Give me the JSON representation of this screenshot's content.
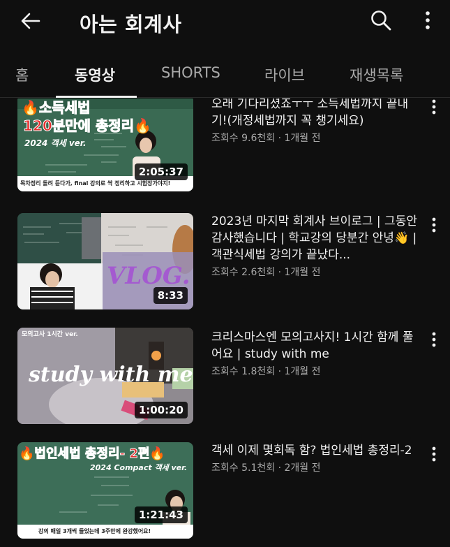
{
  "header": {
    "title": "아는 회계사",
    "back_icon": "arrow-left-icon",
    "search_icon": "search-icon",
    "more_icon": "more-vert-icon"
  },
  "tabs": [
    {
      "label": "홈",
      "active": false
    },
    {
      "label": "동영상",
      "active": true
    },
    {
      "label": "SHORTS",
      "active": false
    },
    {
      "label": "라이브",
      "active": false
    },
    {
      "label": "재생목록",
      "active": false
    }
  ],
  "videos": [
    {
      "title": "오래 기다리셨죠ㅜㅜ 소득세법까지 끝내기!(개정세법까지 꼭 챙기세요)",
      "stats": "조회수 9.6천회 · 1개월 전",
      "duration": "2:05:37",
      "thumb_line1": "🔥소득세법",
      "thumb_line2": "120분만에 총정리🔥",
      "thumb_sub": "2024 객세 ver.",
      "thumb_caption": "목차정리 돌려 듣다가, final 강의로 싹 정리하고 시험장가야지!"
    },
    {
      "title": "2023년 마지막 회계사 브이로그 | 그동안 감사했습니다 | 학교강의 당분간 안녕👋 | 객관식세법 강의가 끝났다...",
      "stats": "조회수 2.6천회 · 1개월 전",
      "duration": "8:33",
      "thumb_vlog": "VLOG."
    },
    {
      "title": "크리스마스엔 모의고사지! 1시간 함께 풀어요 | study with me",
      "stats": "조회수 1.8천회 · 1개월 전",
      "duration": "1:00:20",
      "thumb_corner": "모의고사 1시간 ver.",
      "thumb_script": "study with me"
    },
    {
      "title": "객세 이제 몇회독 함? 법인세법 총정리-2",
      "stats": "조회수 5.1천회 · 2개월 전",
      "duration": "1:21:43",
      "thumb_line1": "🔥법인세법 총정리- 2편🔥",
      "thumb_sub": "2024 Compact 객세 ver.",
      "thumb_caption": "강의 매일 3개씩 들었는데 3주만에 완강했어요!"
    }
  ],
  "colors": {
    "background": "#0f0f0f",
    "text_primary": "#f1f1f1",
    "text_secondary": "#aaaaaa",
    "thumb_red": "#e62e2e",
    "board_green": "#3f6b56"
  }
}
